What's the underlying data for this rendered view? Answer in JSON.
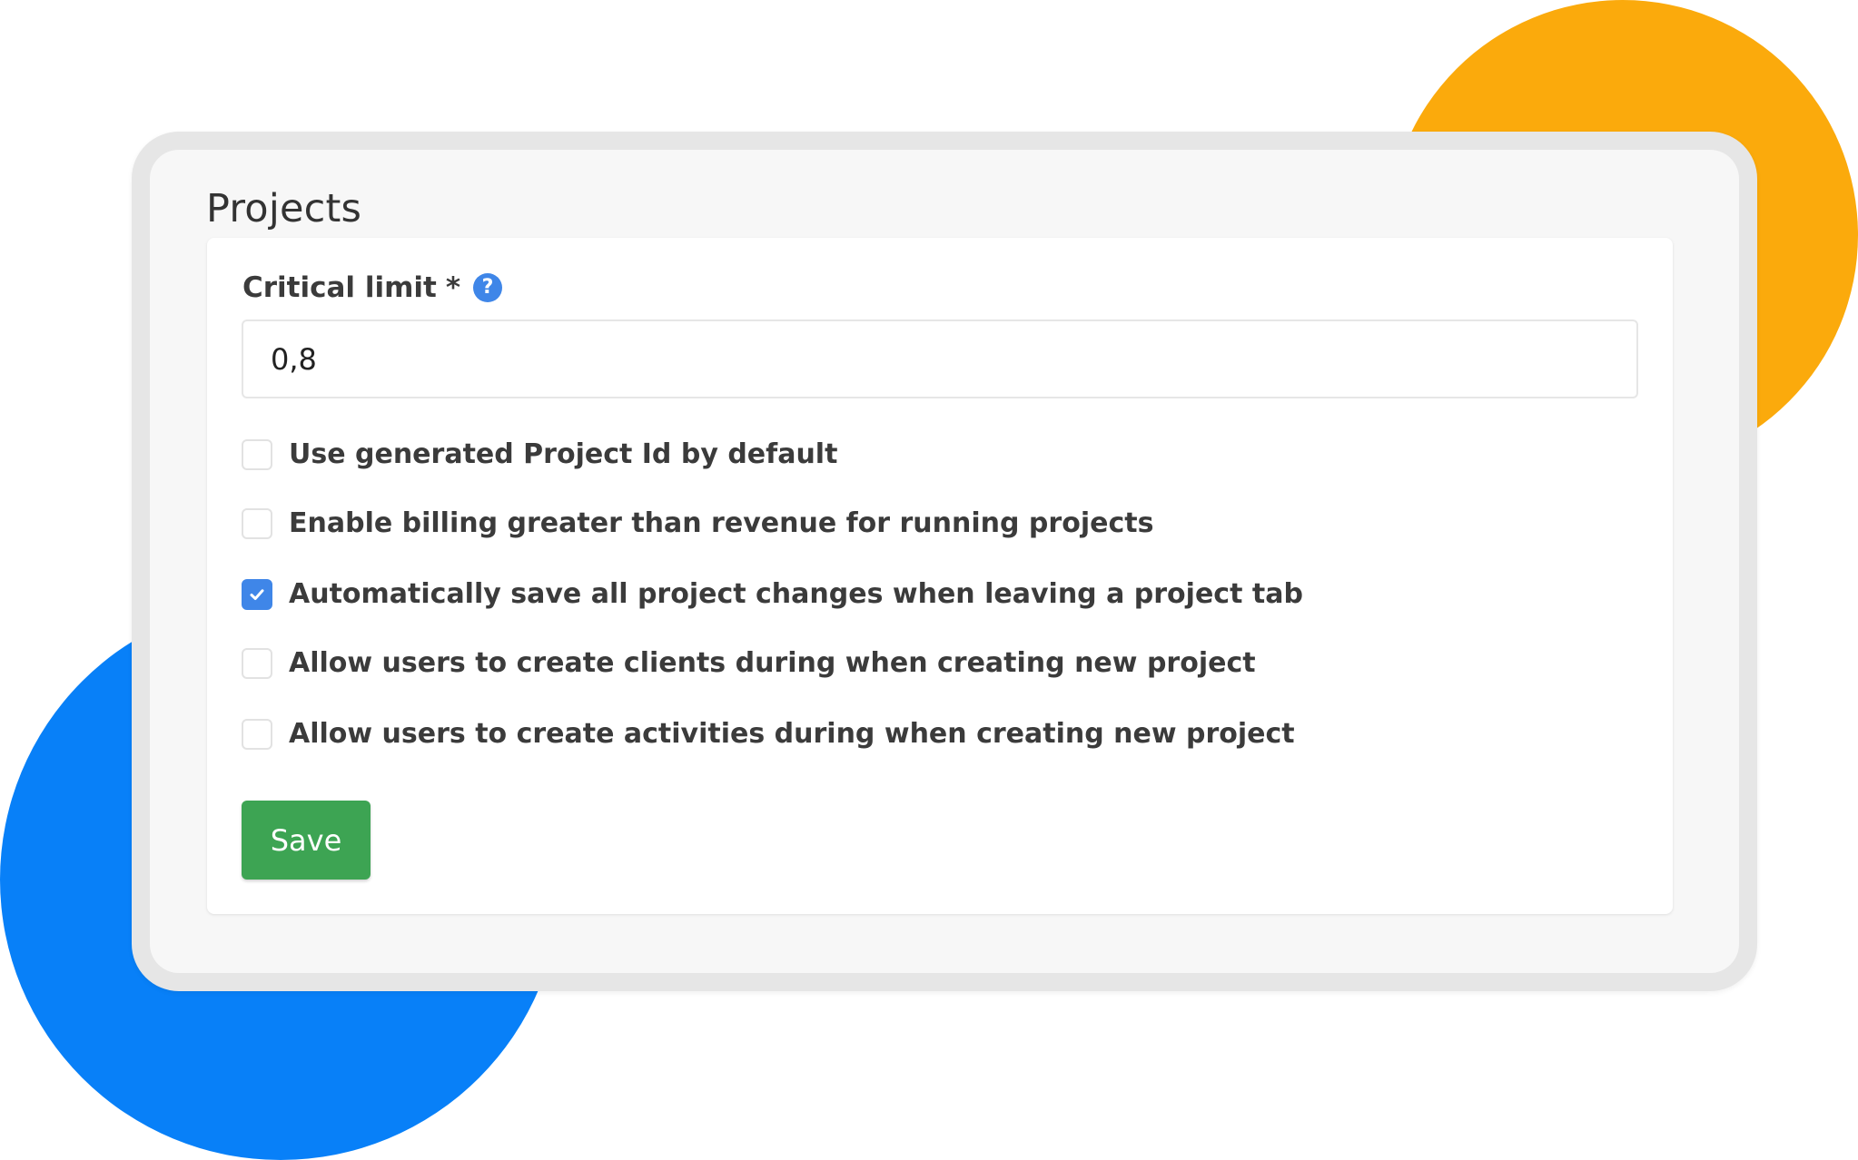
{
  "colors": {
    "accent_orange": "#fbaa0c",
    "accent_blue": "#0880f8",
    "checkbox_checked": "#3f86e8",
    "save_button": "#3da453"
  },
  "page": {
    "title": "Projects"
  },
  "critical_limit": {
    "label": "Critical limit",
    "required_marker": "*",
    "help_icon": "question-circle-icon",
    "help_glyph": "?",
    "value": "0,8"
  },
  "options": [
    {
      "label": "Use generated Project Id by default",
      "checked": false
    },
    {
      "label": "Enable billing greater than revenue for running projects",
      "checked": false
    },
    {
      "label": "Automatically save all project changes when leaving a project tab",
      "checked": true
    },
    {
      "label": "Allow users to create clients during when creating new project",
      "checked": false
    },
    {
      "label": "Allow users to create activities during when creating new project",
      "checked": false
    }
  ],
  "actions": {
    "save_label": "Save"
  }
}
